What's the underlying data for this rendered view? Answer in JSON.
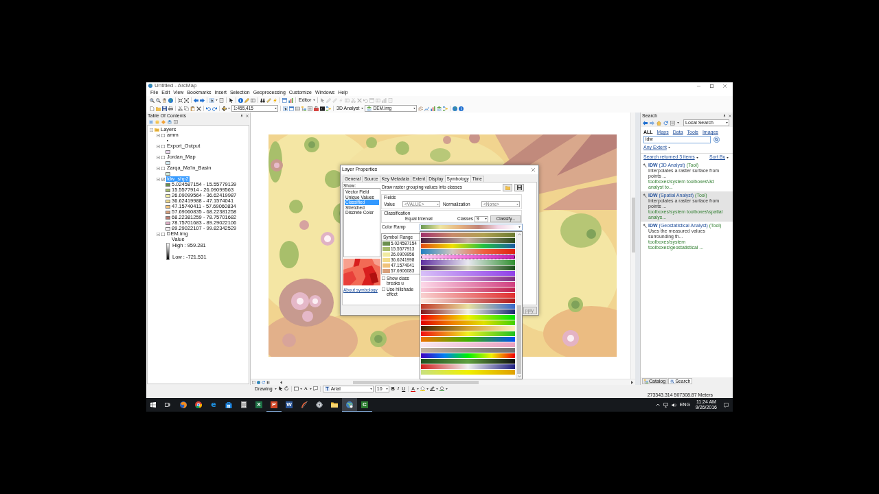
{
  "window": {
    "title": "Untitled - ArcMap"
  },
  "menu": [
    "File",
    "Edit",
    "View",
    "Bookmarks",
    "Insert",
    "Selection",
    "Geoprocessing",
    "Customize",
    "Windows",
    "Help"
  ],
  "toolbars": {
    "editor": "Editor",
    "editor_tools_disabled": true,
    "scale": "1:455,415",
    "analyst": "3D Analyst",
    "layer": "DEM.img"
  },
  "toc": {
    "title": "Table Of Contents",
    "root": {
      "label": "Layers",
      "expanded": true,
      "children": [
        {
          "name": "amm",
          "checked": false,
          "selected": false,
          "expanded": true,
          "legend": [
            {
              "kind": "point"
            }
          ]
        },
        {
          "name": "Export_Output",
          "checked": false,
          "selected": false,
          "expanded": true,
          "legend": [
            {
              "kind": "fill",
              "color": "#e8d4ec"
            }
          ]
        },
        {
          "name": "Jordan_Map",
          "checked": false,
          "selected": false,
          "expanded": true,
          "legend": [
            {
              "kind": "fill",
              "color": "#cde7ee"
            }
          ]
        },
        {
          "name": "Zarqa_Ma'in_Basin",
          "checked": false,
          "selected": false,
          "expanded": true,
          "legend": [
            {
              "kind": "fill",
              "color": "#cfe9d6"
            }
          ]
        },
        {
          "name": "idw_shp2",
          "checked": true,
          "selected": true,
          "expanded": true,
          "legend": [
            {
              "kind": "fill",
              "color": "#6b8f4e",
              "label": "5.024587154 - 15.55779139"
            },
            {
              "kind": "fill",
              "color": "#a8bd6e",
              "label": "15.5577914 - 26.09099563"
            },
            {
              "kind": "fill",
              "color": "#f0eaa0",
              "label": "26.09099564 - 36.62419987"
            },
            {
              "kind": "fill",
              "color": "#f2dc8c",
              "label": "36.62419988 - 47.1574041"
            },
            {
              "kind": "fill",
              "color": "#f0c27a",
              "label": "47.15740411 - 57.69060834"
            },
            {
              "kind": "fill",
              "color": "#d8a07c",
              "label": "57.69060835 - 68.22381258"
            },
            {
              "kind": "fill",
              "color": "#b87a70",
              "label": "68.22381259 - 78.75701682"
            },
            {
              "kind": "fill",
              "color": "#e0b0c8",
              "label": "78.75701683 - 89.29022106"
            },
            {
              "kind": "fill",
              "color": "#f4eef4",
              "label": "89.29022107 - 99.82342529"
            }
          ]
        },
        {
          "name": "DEM.img",
          "checked": false,
          "selected": false,
          "expanded": true,
          "legend": [
            {
              "kind": "caption",
              "label": "Value"
            },
            {
              "kind": "ramp",
              "high": "High : 959.281",
              "low": "Low : -721.531"
            }
          ]
        }
      ]
    }
  },
  "layer_properties": {
    "title": "Layer Properties",
    "tabs": [
      {
        "label": "General",
        "selected": false
      },
      {
        "label": "Source",
        "selected": false
      },
      {
        "label": "Key Metadata",
        "selected": false
      },
      {
        "label": "Extent",
        "selected": false
      },
      {
        "label": "Display",
        "selected": false
      },
      {
        "label": "Symbology",
        "selected": true
      },
      {
        "label": "Time",
        "selected": false
      }
    ],
    "show_label": "Show:",
    "show_items": [
      {
        "label": "Vector Field",
        "selected": false
      },
      {
        "label": "Unique Values",
        "selected": false
      },
      {
        "label": "Classified",
        "selected": true
      },
      {
        "label": "Stretched",
        "selected": false
      },
      {
        "label": "Discrete Color",
        "selected": false
      }
    ],
    "link": "About symbology",
    "description": "Draw raster grouping values into classes",
    "fields": {
      "title": "Fields",
      "value_label": "Value",
      "value": "<VALUE>",
      "normalization_label": "Normalization",
      "normalization": "<None>",
      "disabled": true
    },
    "classification": {
      "title": "Classification",
      "method": "Equal Interval",
      "classes_label": "Classes",
      "classes": "9",
      "button": "Classify..."
    },
    "color_ramp_label": "Color Ramp",
    "table": {
      "columns": [
        "Symbol",
        "Range"
      ],
      "rows": [
        {
          "color": "#6b8f4e",
          "range": "5.024587154"
        },
        {
          "color": "#a8bd6e",
          "range": "15.5577913"
        },
        {
          "color": "#f0eaa0",
          "range": "26.0909956"
        },
        {
          "color": "#f2dc8c",
          "range": "36.6241998"
        },
        {
          "color": "#f0c27a",
          "range": "47.1574041"
        },
        {
          "color": "#d8a07c",
          "range": "57.6906083"
        }
      ]
    },
    "options": [
      {
        "label": "Show class breaks u",
        "checked": false
      },
      {
        "label": "Use hillshade effect",
        "checked": false
      }
    ],
    "apply": {
      "label": "pply",
      "disabled": true
    }
  },
  "color_ramp_list": [
    {
      "selected": false
    },
    {
      "selected": false
    },
    {
      "selected": false
    },
    {
      "selected": false
    },
    {
      "selected": true
    },
    {
      "selected": false
    },
    {
      "selected": false
    },
    {
      "selected": false
    },
    {
      "selected": false
    },
    {
      "selected": false
    },
    {
      "selected": false
    },
    {
      "selected": false
    },
    {
      "selected": false
    },
    {
      "selected": false
    },
    {
      "selected": false
    },
    {
      "selected": false
    },
    {
      "selected": false
    },
    {
      "selected": false
    },
    {
      "selected": false
    },
    {
      "selected": false
    },
    {
      "selected": false
    },
    {
      "selected": false
    },
    {
      "selected": false
    },
    {
      "selected": false
    },
    {
      "selected": false
    },
    {
      "selected": false
    }
  ],
  "search": {
    "title": "Search",
    "scope": "Local Search",
    "tabs": [
      {
        "label": "ALL",
        "selected": true
      },
      {
        "label": "Maps",
        "selected": false
      },
      {
        "label": "Data",
        "selected": false
      },
      {
        "label": "Tools",
        "selected": false
      },
      {
        "label": "Images",
        "selected": false
      }
    ],
    "query": "idw",
    "extent": "Any Extent",
    "summary": "Search returned 3 items",
    "sort": "Sort By",
    "results": [
      {
        "name": "IDW",
        "toolbox": "(3D Analyst)",
        "type": "(Tool)",
        "description": "Interpolates a raster surface from points ...",
        "path": "toolboxes\\system toolboxes\\3d analyst to...",
        "selected": false
      },
      {
        "name": "IDW",
        "toolbox": "(Spatial Analyst)",
        "type": "(Tool)",
        "description": "Interpolates a raster surface from points ...",
        "path": "toolboxes\\system toolboxes\\spatial analys...",
        "selected": true
      },
      {
        "name": "IDW",
        "toolbox": "(Geostatistical Analyst)",
        "type": "(Tool)",
        "description": "Uses the measured values surrounding th...",
        "path": "toolboxes\\system toolboxes\\geostatistical ...",
        "selected": false
      }
    ]
  },
  "panel_tabs": [
    {
      "label": "Catalog",
      "selected": false
    },
    {
      "label": "Search",
      "selected": true
    }
  ],
  "drawing_toolbar": {
    "label": "Drawing",
    "text_tool": "A",
    "font": "Arial",
    "size": "10",
    "bold": "B",
    "italic": "I",
    "underline": "U",
    "font_color": "A"
  },
  "status_bar": {
    "coordinates": "273343.314 507308.87 Meters"
  },
  "taskbar": {
    "apps": [
      {
        "kind": "foxglobe",
        "running": false,
        "active": false
      },
      {
        "kind": "ringglobe",
        "running": false,
        "active": false
      },
      {
        "kind": "glyph",
        "glyph": "e",
        "color": "#1e90e0",
        "running": false,
        "active": false
      },
      {
        "kind": "store",
        "running": false,
        "active": false
      },
      {
        "kind": "calculator",
        "running": false,
        "active": false
      },
      {
        "kind": "tile",
        "glyph": "X",
        "color": "#1e7145",
        "running": false,
        "active": false
      },
      {
        "kind": "tile",
        "glyph": "P",
        "color": "#d24726",
        "running": true,
        "active": false
      },
      {
        "kind": "tile",
        "glyph": "W",
        "color": "#2b579a",
        "running": false,
        "active": false
      },
      {
        "kind": "feather",
        "running": false,
        "active": false
      },
      {
        "kind": "gearglobe",
        "running": false,
        "active": false
      },
      {
        "kind": "folder",
        "running": false,
        "active": false
      },
      {
        "kind": "mapglobe",
        "running": true,
        "active": true
      },
      {
        "kind": "tile",
        "glyph": "C",
        "color": "#2e7d32",
        "running": true,
        "active": false
      }
    ],
    "language": "ENG",
    "time": "11:24 AM",
    "date": "9/26/2016"
  }
}
